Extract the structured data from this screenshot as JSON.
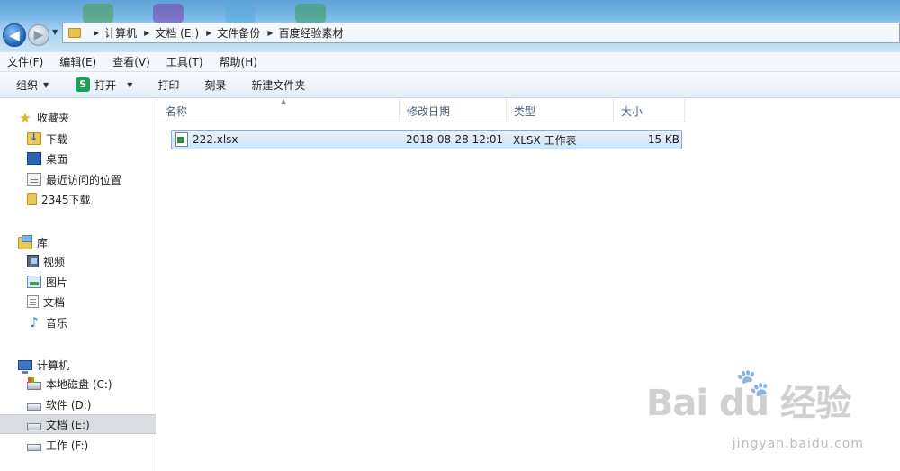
{
  "address_bar": {
    "crumbs": [
      "计算机",
      "文档 (E:)",
      "文件备份",
      "百度经验素材"
    ]
  },
  "menu": [
    "文件(F)",
    "编辑(E)",
    "查看(V)",
    "工具(T)",
    "帮助(H)"
  ],
  "toolbar": {
    "organize": "组织",
    "open": "打开",
    "open_icon_letter": "S",
    "print": "打印",
    "burn": "刻录",
    "new_folder": "新建文件夹"
  },
  "nav": {
    "favorites": {
      "label": "收藏夹",
      "items": [
        "下载",
        "桌面",
        "最近访问的位置",
        "2345下载"
      ]
    },
    "libraries": {
      "label": "库",
      "items": [
        "视频",
        "图片",
        "文档",
        "音乐"
      ]
    },
    "computer": {
      "label": "计算机",
      "items": [
        "本地磁盘 (C:)",
        "软件 (D:)",
        "文档 (E:)",
        "工作 (F:)"
      ],
      "selected": "文档 (E:)"
    }
  },
  "columns": [
    "名称",
    "修改日期",
    "类型",
    "大小"
  ],
  "files": [
    {
      "name": "222.xlsx",
      "modified": "2018-08-28 12:01",
      "type": "XLSX 工作表",
      "size": "15 KB"
    }
  ],
  "watermark": {
    "text": "Bai du 经验",
    "url": "jingyan.baidu.com"
  },
  "colors": {
    "selection_bg": "#cfe4f8",
    "selection_border": "#84acdd",
    "titlebar": "#77b6e4"
  }
}
